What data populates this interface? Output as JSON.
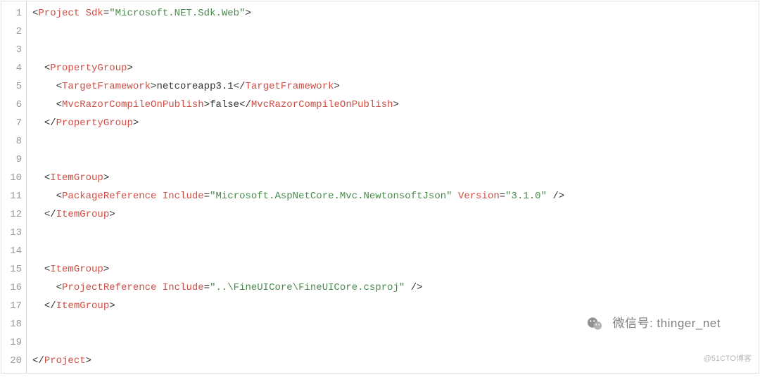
{
  "lineCount": 20,
  "code": {
    "l1": {
      "tag": "Project",
      "attr": "Sdk",
      "val": "\"Microsoft.NET.Sdk.Web\""
    },
    "l4": {
      "open": "PropertyGroup"
    },
    "l5": {
      "tag": "TargetFramework",
      "text": "netcoreapp3.1"
    },
    "l6": {
      "tag": "MvcRazorCompileOnPublish",
      "text": "false"
    },
    "l7": {
      "close": "PropertyGroup"
    },
    "l10": {
      "open": "ItemGroup"
    },
    "l11": {
      "tag": "PackageReference",
      "attr1": "Include",
      "val1": "\"Microsoft.AspNetCore.Mvc.NewtonsoftJson\"",
      "attr2": "Version",
      "val2": "\"3.1.0\""
    },
    "l12": {
      "close": "ItemGroup"
    },
    "l15": {
      "open": "ItemGroup"
    },
    "l16": {
      "tag": "ProjectReference",
      "attr1": "Include",
      "val1": "\"..\\FineUICore\\FineUICore.csproj\""
    },
    "l17": {
      "close": "ItemGroup"
    },
    "l20": {
      "close": "Project"
    }
  },
  "watermark": {
    "label": "微信号",
    "value": "thinger_net"
  },
  "attribution": "@51CTO博客"
}
